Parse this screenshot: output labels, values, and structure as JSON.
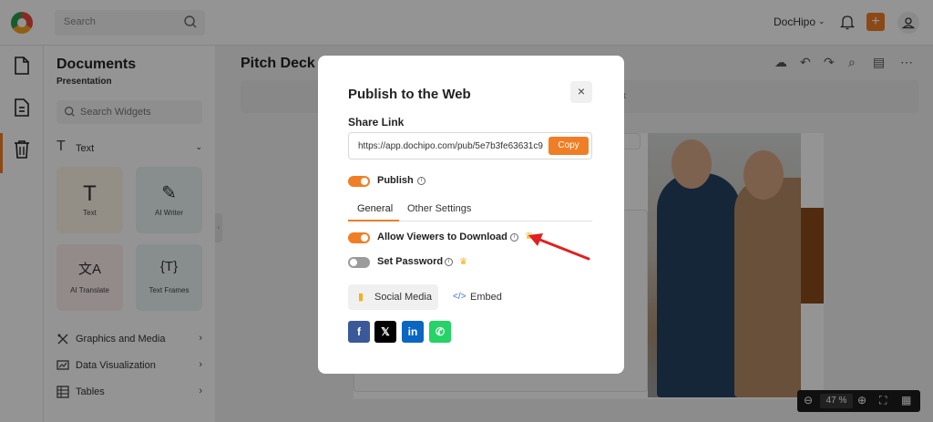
{
  "topbar": {
    "search_placeholder": "Search",
    "brand": "DocHipo"
  },
  "panel": {
    "title": "Documents",
    "subtitle": "Presentation",
    "widget_search_placeholder": "Search Widgets",
    "text_section": "Text",
    "tiles": [
      {
        "label": "Text",
        "icon": "text-t-icon",
        "color": "#fdf6e8"
      },
      {
        "label": "AI Writer",
        "icon": "ai-writer-pen-icon",
        "color": "#eaf3f5"
      },
      {
        "label": "AI Translate",
        "icon": "translate-icon",
        "color": "#fdeeee"
      },
      {
        "label": "Text Frames",
        "icon": "text-frames-icon",
        "color": "#eaf3f5"
      }
    ],
    "items": [
      {
        "label": "Graphics and Media",
        "icon": "graphics-icon"
      },
      {
        "label": "Data Visualization",
        "icon": "chart-icon"
      },
      {
        "label": "Tables",
        "icon": "table-icon"
      }
    ]
  },
  "canvas": {
    "doc_title": "Pitch Deck",
    "zoom": "47 %",
    "hint_close": "x"
  },
  "modal": {
    "title": "Publish to the Web",
    "close_label": "×",
    "share_label": "Share Link",
    "url": "https://app.dochipo.com/pub/5e7b3fe63631c9",
    "copy_label": "Copy",
    "publish_label": "Publish",
    "publish_on": true,
    "tabs": [
      "General",
      "Other Settings"
    ],
    "active_tab": "General",
    "allow_download_label": "Allow Viewers to Download",
    "allow_download_on": true,
    "set_password_label": "Set Password",
    "set_password_on": false,
    "share_tabs": [
      "Social Media",
      "Embed"
    ],
    "social_buttons": [
      {
        "name": "facebook",
        "glyph": "f",
        "color": "#3b5998"
      },
      {
        "name": "x",
        "glyph": "𝕏",
        "color": "#000000"
      },
      {
        "name": "linkedin",
        "glyph": "in",
        "color": "#0a66c2"
      },
      {
        "name": "whatsapp",
        "glyph": "✆",
        "color": "#25d366"
      }
    ]
  },
  "colors": {
    "accent": "#f07e26",
    "annotation_arrow": "#e02020"
  }
}
